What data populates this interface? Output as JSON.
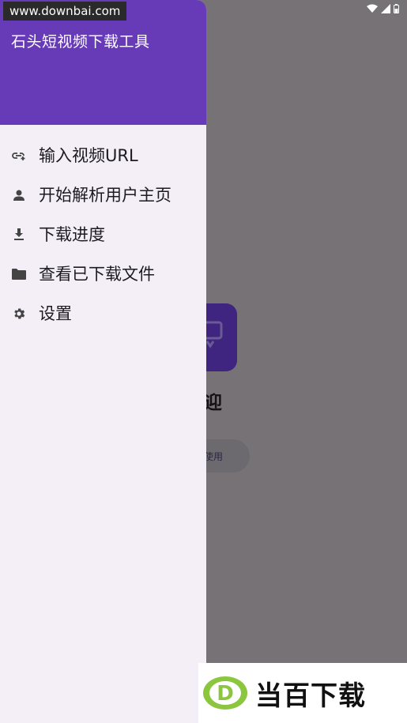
{
  "watermark_top": "www.downbai.com",
  "drawer": {
    "title": "石头短视频下载工具",
    "items": [
      {
        "label": "输入视频URL",
        "icon": "link-add-icon"
      },
      {
        "label": "开始解析用户主页",
        "icon": "person-icon"
      },
      {
        "label": "下载进度",
        "icon": "download-icon"
      },
      {
        "label": "查看已下载文件",
        "icon": "folder-icon"
      },
      {
        "label": "设置",
        "icon": "gear-icon"
      }
    ]
  },
  "main": {
    "welcome_partial": "迎",
    "start_button_partial": "使用"
  },
  "watermark_bottom": {
    "logo_letter": "D",
    "text": "当百下载"
  },
  "colors": {
    "header": "#673ab7",
    "drawer_bg": "#f4eff7",
    "scrim": "#767275",
    "card": "#3f2480"
  }
}
